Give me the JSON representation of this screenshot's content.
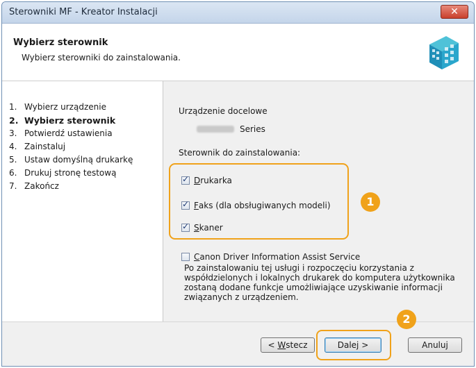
{
  "window": {
    "title": "Sterowniki MF - Kreator Instalacji",
    "close": "✕"
  },
  "header": {
    "title": "Wybierz sterownik",
    "subtitle": "Wybierz sterowniki do zainstalowania."
  },
  "steps": [
    {
      "num": "1.",
      "label": "Wybierz urządzenie"
    },
    {
      "num": "2.",
      "label": "Wybierz sterownik"
    },
    {
      "num": "3.",
      "label": "Potwierdź ustawienia"
    },
    {
      "num": "4.",
      "label": "Zainstaluj"
    },
    {
      "num": "5.",
      "label": "Ustaw domyślną drukarkę"
    },
    {
      "num": "6.",
      "label": "Drukuj stronę testową"
    },
    {
      "num": "7.",
      "label": "Zakończ"
    }
  ],
  "panel": {
    "device_label": "Urządzenie docelowe",
    "device_name": "Series",
    "driver_label": "Sterownik do zainstalowania:",
    "drivers": [
      {
        "hot": "D",
        "rest": "rukarka",
        "checked": true
      },
      {
        "hot": "F",
        "rest": "aks (dla obsługiwanych modeli)",
        "checked": true
      },
      {
        "hot": "S",
        "rest": "kaner",
        "checked": true
      }
    ],
    "assist": {
      "hot": "C",
      "rest": "anon Driver Information Assist Service",
      "checked": false
    },
    "assist_description": "Po zainstalowaniu tej usługi i rozpoczęciu korzystania z współdzielonych i lokalnych drukarek do komputera użytkownika zostaną dodane funkcje umożliwiające uzyskiwanie informacji związanych z urządzeniem."
  },
  "annotations": {
    "badge1": "1",
    "badge2": "2",
    "accent": "#f0a21a"
  },
  "footer": {
    "back_prefix": "< ",
    "back_hot": "W",
    "back_rest": "stecz",
    "next_label": "Dalej >",
    "cancel_label": "Anuluj"
  }
}
